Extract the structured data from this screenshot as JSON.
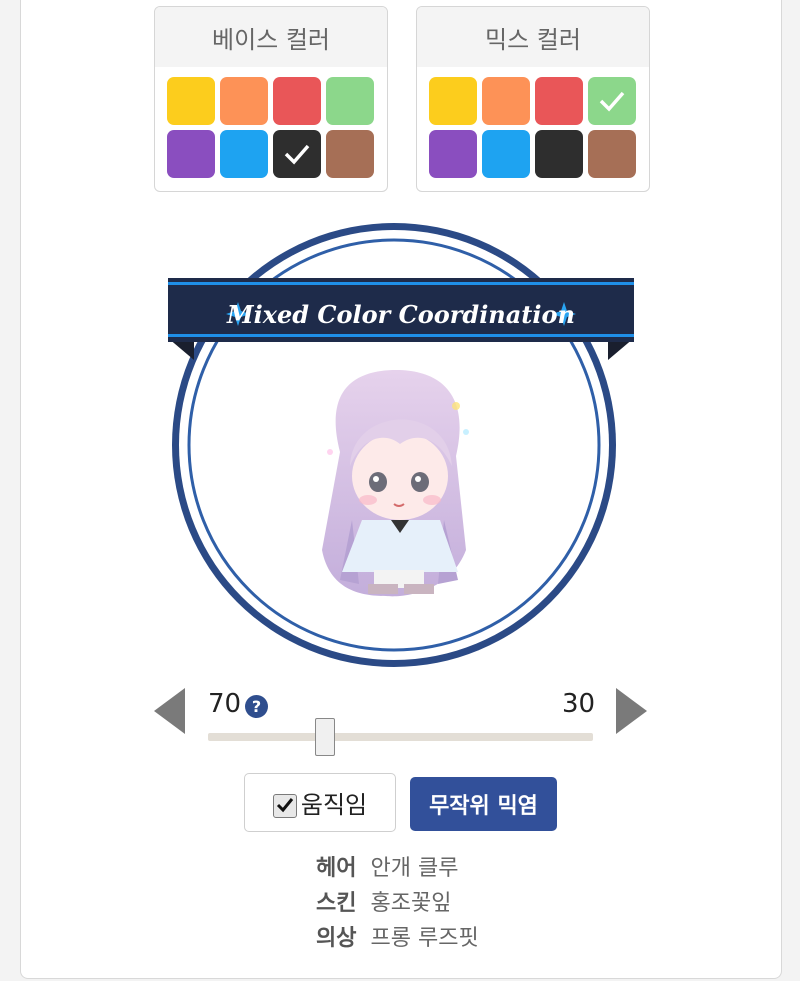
{
  "base_palette": {
    "title": "베이스 컬러",
    "swatches": [
      "#fccd1d",
      "#fd9257",
      "#e95658",
      "#8cd78b",
      "#8a4ebf",
      "#1ea3f1",
      "#2e2e2e",
      "#a66f56"
    ],
    "selected_index": 6
  },
  "mix_palette": {
    "title": "믹스 컬러",
    "swatches": [
      "#fccd1d",
      "#fd9257",
      "#e95658",
      "#8cd78b",
      "#8a4ebf",
      "#1ea3f1",
      "#2e2e2e",
      "#a66f56"
    ],
    "selected_index": 3
  },
  "preview": {
    "banner_text": "Mixed Color Coordination",
    "ring_color": "#2b4a86",
    "banner_color": "#1e2b4a",
    "accent_color": "#1f8fe8"
  },
  "ratio": {
    "base_value": "70",
    "mix_value": "30",
    "help_symbol": "?",
    "slider_value_percent": 30
  },
  "controls": {
    "move_label": "움직임",
    "move_checked": true,
    "random_label": "무작위 믹염"
  },
  "details": [
    {
      "key": "헤어",
      "value": "안개 클루"
    },
    {
      "key": "스킨",
      "value": "홍조꽃잎"
    },
    {
      "key": "의상",
      "value": "프롱 루즈핏"
    }
  ]
}
